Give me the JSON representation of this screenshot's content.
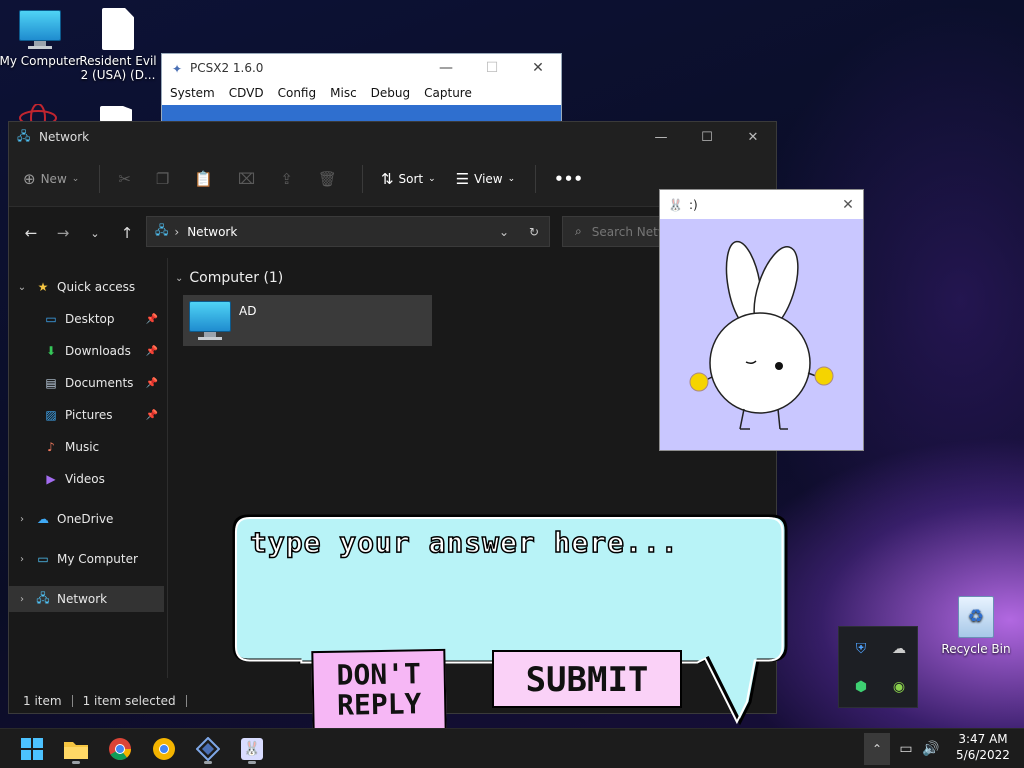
{
  "desktop": {
    "icons": [
      {
        "label": "My Computer",
        "icon": "monitor-icon"
      },
      {
        "label": "Resident Evil 2 (USA) (D...",
        "icon": "document-icon"
      }
    ],
    "recycle_bin": {
      "label": "Recycle Bin",
      "icon": "recycle-bin-icon"
    },
    "wallpaper_accent": "#c77dff"
  },
  "pcsx2": {
    "title": "PCSX2  1.6.0",
    "menu": [
      "System",
      "CDVD",
      "Config",
      "Misc",
      "Debug",
      "Capture"
    ]
  },
  "explorer": {
    "title": "Network",
    "commands": {
      "new": "New",
      "sort": "Sort",
      "view": "View"
    },
    "address": {
      "path": "Network"
    },
    "search": {
      "placeholder": "Search Network"
    },
    "nav": {
      "quick_access": "Quick access",
      "items": [
        {
          "label": "Desktop",
          "pinned": true
        },
        {
          "label": "Downloads",
          "pinned": true
        },
        {
          "label": "Documents",
          "pinned": true
        },
        {
          "label": "Pictures",
          "pinned": true
        },
        {
          "label": "Music",
          "pinned": false
        },
        {
          "label": "Videos",
          "pinned": false
        }
      ],
      "onedrive": "OneDrive",
      "my_computer": "My Computer",
      "network": "Network"
    },
    "content": {
      "group_label": "Computer (1)",
      "items": [
        {
          "name": "AD"
        }
      ]
    },
    "status": {
      "count": "1 item",
      "selected": "1 item selected"
    }
  },
  "popup": {
    "title": ":)"
  },
  "bubble": {
    "prompt": "type your answer here...",
    "dont_reply": "DON'T REPLY",
    "submit": "SUBMIT",
    "fill_color": "#b8f3f7"
  },
  "taskbar": {
    "time": "3:47 AM",
    "date": "5/6/2022"
  }
}
